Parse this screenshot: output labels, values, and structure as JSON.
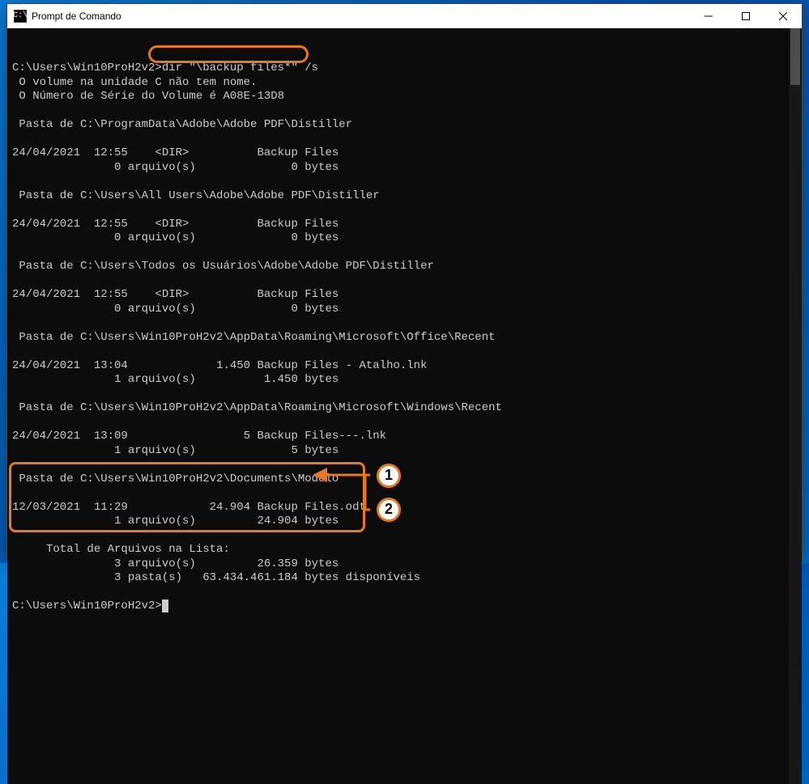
{
  "window": {
    "title": "Prompt de Comando"
  },
  "prompt": {
    "path1": "C:\\Users\\Win10ProH2v2>",
    "command": "dir \"\\backup files*\" /s",
    "path2": "C:\\Users\\Win10ProH2v2>"
  },
  "lines": {
    "vol1": " O volume na unidade C não tem nome.",
    "vol2": " O Número de Série do Volume é A08E-13D8",
    "p1": " Pasta de C:\\ProgramData\\Adobe\\Adobe PDF\\Distiller",
    "r1a": "24/04/2021  12:55    <DIR>          Backup Files",
    "r1b": "               0 arquivo(s)              0 bytes",
    "p2": " Pasta de C:\\Users\\All Users\\Adobe\\Adobe PDF\\Distiller",
    "r2a": "24/04/2021  12:55    <DIR>          Backup Files",
    "r2b": "               0 arquivo(s)              0 bytes",
    "p3": " Pasta de C:\\Users\\Todos os Usuários\\Adobe\\Adobe PDF\\Distiller",
    "r3a": "24/04/2021  12:55    <DIR>          Backup Files",
    "r3b": "               0 arquivo(s)              0 bytes",
    "p4": " Pasta de C:\\Users\\Win10ProH2v2\\AppData\\Roaming\\Microsoft\\Office\\Recent",
    "r4a": "24/04/2021  13:04             1.450 Backup Files - Atalho.lnk",
    "r4b": "               1 arquivo(s)          1.450 bytes",
    "p5": " Pasta de C:\\Users\\Win10ProH2v2\\AppData\\Roaming\\Microsoft\\Windows\\Recent",
    "r5a": "24/04/2021  13:09                 5 Backup Files---.lnk",
    "r5b": "               1 arquivo(s)              5 bytes",
    "p6": " Pasta de C:\\Users\\Win10ProH2v2\\Documents\\Modelo",
    "r6a": "12/03/2021  11:29            24.904 Backup Files.odt",
    "r6b": "               1 arquivo(s)         24.904 bytes",
    "tot1": "     Total de Arquivos na Lista:",
    "tot2": "               3 arquivo(s)         26.359 bytes",
    "tot3": "               3 pasta(s)   63.434.461.184 bytes disponíveis"
  },
  "annotations": {
    "callout1": "1",
    "callout2": "2"
  }
}
